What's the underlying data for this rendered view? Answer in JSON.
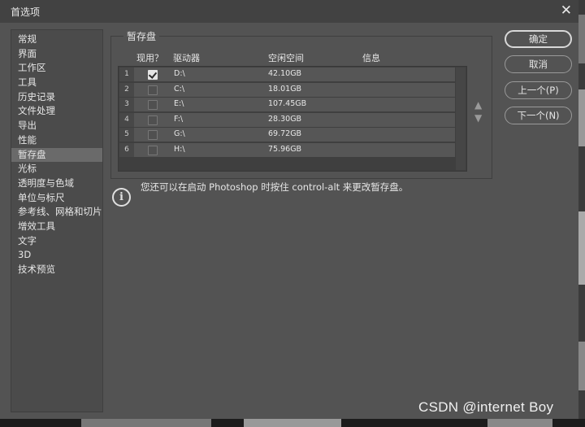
{
  "window": {
    "title": "首选项",
    "close_symbol": "✕"
  },
  "nav": {
    "items": [
      "常规",
      "界面",
      "工作区",
      "工具",
      "历史记录",
      "文件处理",
      "导出",
      "性能",
      "暂存盘",
      "光标",
      "透明度与色域",
      "单位与标尺",
      "参考线、网格和切片",
      "增效工具",
      "文字",
      "3D",
      "技术预览"
    ],
    "selected": "暂存盘"
  },
  "scratch": {
    "title": "暂存盘",
    "columns": {
      "active": "现用？",
      "drive": "驱动器",
      "free": "空闲空间",
      "info": "信息"
    },
    "rows": [
      {
        "num": "1",
        "checked": true,
        "drive": "D:\\",
        "free": "42.10GB"
      },
      {
        "num": "2",
        "checked": false,
        "drive": "C:\\",
        "free": "18.01GB"
      },
      {
        "num": "3",
        "checked": false,
        "drive": "E:\\",
        "free": "107.45GB"
      },
      {
        "num": "4",
        "checked": false,
        "drive": "F:\\",
        "free": "28.30GB"
      },
      {
        "num": "5",
        "checked": false,
        "drive": "G:\\",
        "free": "69.72GB"
      },
      {
        "num": "6",
        "checked": false,
        "drive": "H:\\",
        "free": "75.96GB"
      }
    ],
    "up_arrow": "▲",
    "down_arrow": "▼"
  },
  "info": {
    "icon": "i",
    "text": "您还可以在启动 Photoshop 时按住 control-alt 来更改暂存盘。"
  },
  "buttons": {
    "ok": "确定",
    "cancel": "取消",
    "prev": "上一个(P)",
    "next": "下一个(N)"
  },
  "watermark": "CSDN @internet   Boy"
}
